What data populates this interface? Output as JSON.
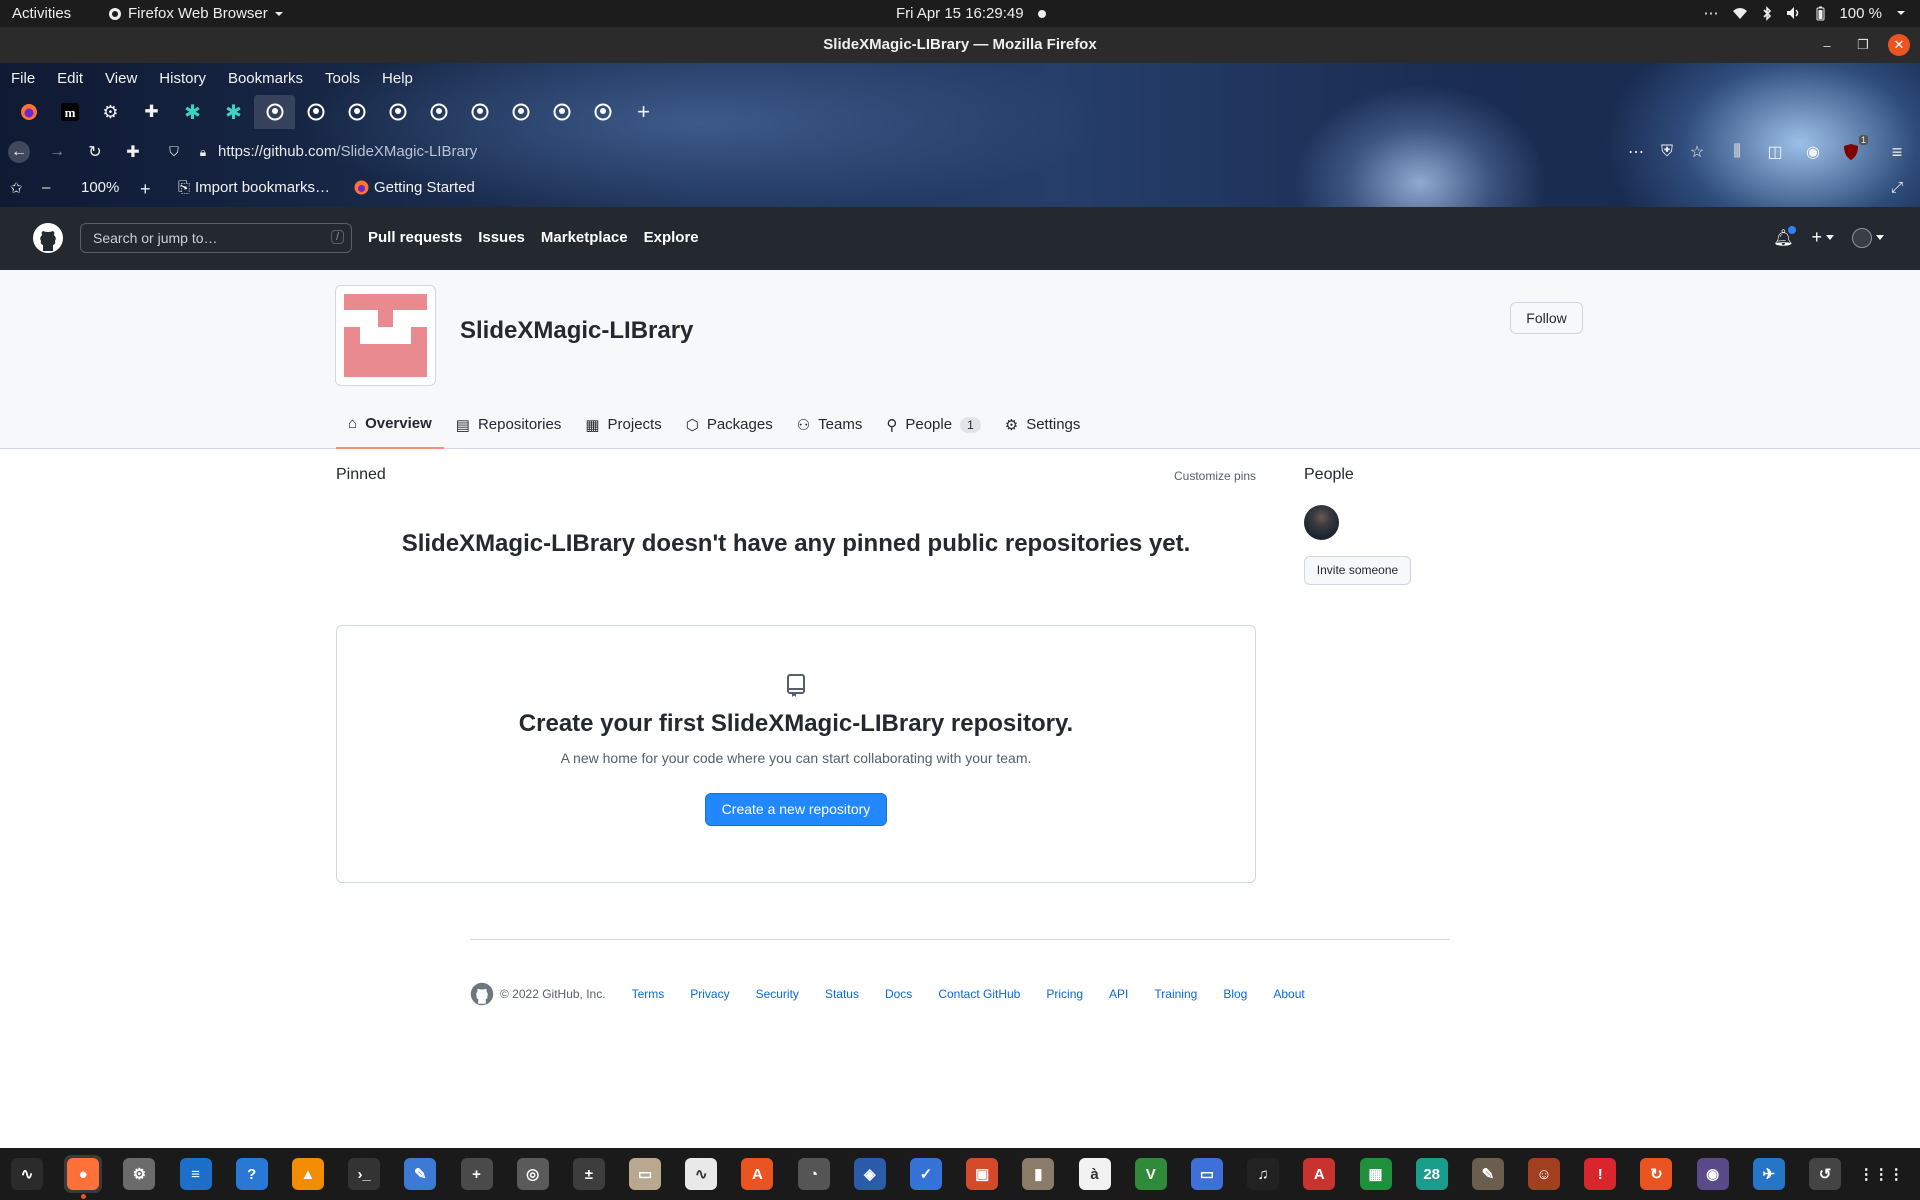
{
  "system": {
    "activities": "Activities",
    "app_name": "Firefox Web Browser",
    "datetime": "Fri Apr 15  16:29:49",
    "battery": "100 %"
  },
  "window": {
    "title": "SlideXMagic-LIBrary — Mozilla Firefox"
  },
  "menu": [
    "File",
    "Edit",
    "View",
    "History",
    "Bookmarks",
    "Tools",
    "Help"
  ],
  "url": {
    "base": "https://github.com",
    "path": "/SlideXMagic-LIBrary"
  },
  "zoom": "100%",
  "bookmarks": {
    "import": "Import bookmarks…",
    "getting_started": "Getting Started"
  },
  "ublock_badge": "1",
  "github": {
    "search_placeholder": "Search or jump to…",
    "slash_key": "/",
    "nav": [
      "Pull requests",
      "Issues",
      "Marketplace",
      "Explore"
    ],
    "plus": "+"
  },
  "org": {
    "name": "SlideXMagic-LIBrary",
    "follow": "Follow",
    "tabs": [
      {
        "label": "Overview",
        "icon": "book-icon"
      },
      {
        "label": "Repositories",
        "icon": "repo-icon"
      },
      {
        "label": "Projects",
        "icon": "table-icon"
      },
      {
        "label": "Packages",
        "icon": "package-icon"
      },
      {
        "label": "Teams",
        "icon": "people-icon"
      },
      {
        "label": "People",
        "icon": "person-icon",
        "count": "1"
      },
      {
        "label": "Settings",
        "icon": "gear-icon"
      }
    ]
  },
  "main": {
    "pinned": "Pinned",
    "customize": "Customize pins",
    "no_pinned": "SlideXMagic-LIBrary doesn't have any pinned public repositories yet.",
    "blank_title": "Create your first SlideXMagic-LIBrary repository.",
    "blank_desc": "A new home for your code where you can start collaborating with your team.",
    "create_btn": "Create a new repository"
  },
  "sidebar": {
    "people": "People",
    "invite": "Invite someone"
  },
  "footer": {
    "copyright": "© 2022 GitHub, Inc.",
    "links": [
      "Terms",
      "Privacy",
      "Security",
      "Status",
      "Docs",
      "Contact GitHub",
      "Pricing",
      "API",
      "Training",
      "Blog",
      "About"
    ]
  },
  "dock": [
    "system-monitor-icon",
    "firefox-icon",
    "settings-icon",
    "writer-icon",
    "help-icon",
    "vlc-icon",
    "terminal-icon",
    "text-editor-icon",
    "add-document-icon",
    "image-viewer-icon",
    "calculator-icon",
    "files-icon",
    "graph-icon",
    "app-store-icon",
    "disk-usage-icon",
    "scan-icon",
    "tasks-icon",
    "presentation-icon",
    "archive-icon",
    "character-map-icon",
    "vim-icon",
    "remote-desktop-icon",
    "music-icon",
    "pdf-icon",
    "spreadsheet-icon",
    "calendar-icon",
    "gimp-icon",
    "game-icon",
    "alert-icon",
    "update-icon",
    "screenshot-icon",
    "travel-icon",
    "software-updater-icon",
    "app-grid-icon"
  ],
  "calendar_day": "28"
}
